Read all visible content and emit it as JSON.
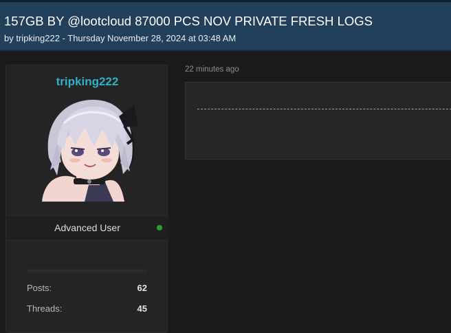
{
  "thread": {
    "title": "157GB BY @lootcloud 87000 PCS NOV PRIVATE FRESH LOGS",
    "meta": "by tripking222 - Thursday November 28, 2024 at 03:48 AM"
  },
  "author": {
    "name": "tripking222",
    "rank": "Advanced User",
    "online_status_color": "#2f9b2f",
    "avatar_icon": "anime-avatar-icon",
    "stats": [
      {
        "label": "Posts:",
        "value": "62"
      },
      {
        "label": "Threads:",
        "value": "45"
      }
    ]
  },
  "post": {
    "time": "22 minutes ago"
  },
  "colors": {
    "header_bg": "#223f5c",
    "username": "#2fb0c4",
    "page_bg": "#1b1b1b"
  }
}
